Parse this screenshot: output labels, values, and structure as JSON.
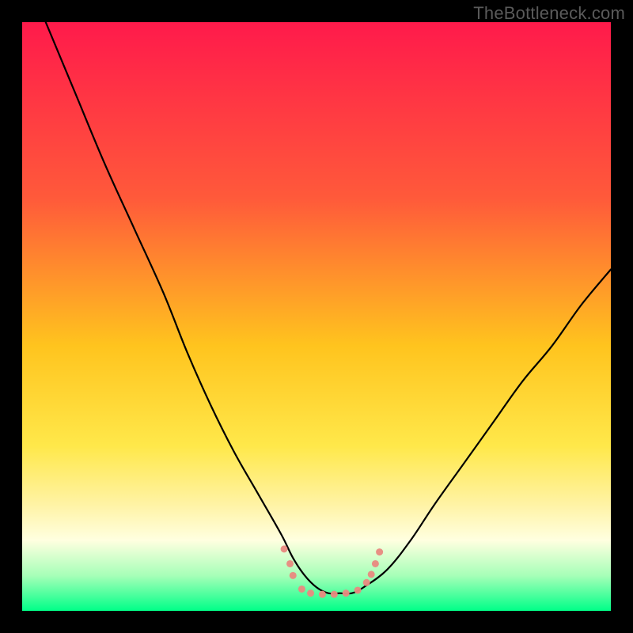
{
  "watermark": "TheBottleneck.com",
  "chart_data": {
    "type": "line",
    "title": "",
    "xlabel": "",
    "ylabel": "",
    "xlim": [
      0,
      100
    ],
    "ylim": [
      0,
      100
    ],
    "grid": false,
    "legend": false,
    "background_gradient": {
      "stops": [
        {
          "pos": 0.0,
          "color": "#ff1a4b"
        },
        {
          "pos": 0.3,
          "color": "#ff5a3a"
        },
        {
          "pos": 0.55,
          "color": "#ffc41e"
        },
        {
          "pos": 0.72,
          "color": "#ffe84a"
        },
        {
          "pos": 0.82,
          "color": "#fff3a5"
        },
        {
          "pos": 0.88,
          "color": "#ffffe0"
        },
        {
          "pos": 0.94,
          "color": "#a7ffb8"
        },
        {
          "pos": 1.0,
          "color": "#00ff88"
        }
      ]
    },
    "series": [
      {
        "name": "bottleneck-curve",
        "color": "#000000",
        "x": [
          4,
          9,
          14,
          19,
          24,
          28,
          32,
          36,
          40,
          44,
          46,
          48,
          50,
          52,
          54,
          56,
          58,
          62,
          66,
          70,
          75,
          80,
          85,
          90,
          95,
          100
        ],
        "y": [
          100,
          88,
          76,
          65,
          54,
          44,
          35,
          27,
          20,
          13,
          9,
          6,
          4,
          3,
          3,
          3,
          4,
          7,
          12,
          18,
          25,
          32,
          39,
          45,
          52,
          58
        ]
      }
    ],
    "markers": {
      "name": "optimum-zone",
      "color": "#e88a80",
      "points": [
        {
          "x": 44.5,
          "y": 10.5,
          "r": 1.2
        },
        {
          "x": 45.5,
          "y": 8.0,
          "r": 1.2
        },
        {
          "x": 46.0,
          "y": 6.0,
          "r": 1.4
        },
        {
          "x": 47.5,
          "y": 3.7,
          "r": 1.4
        },
        {
          "x": 49.0,
          "y": 3.0,
          "r": 1.4
        },
        {
          "x": 51.0,
          "y": 2.8,
          "r": 1.4
        },
        {
          "x": 53.0,
          "y": 2.8,
          "r": 1.4
        },
        {
          "x": 55.0,
          "y": 3.0,
          "r": 1.4
        },
        {
          "x": 57.0,
          "y": 3.5,
          "r": 1.4
        },
        {
          "x": 58.5,
          "y": 4.8,
          "r": 1.4
        },
        {
          "x": 59.3,
          "y": 6.2,
          "r": 1.4
        },
        {
          "x": 60.0,
          "y": 8.0,
          "r": 1.3
        },
        {
          "x": 60.7,
          "y": 10.0,
          "r": 1.2
        }
      ]
    }
  }
}
